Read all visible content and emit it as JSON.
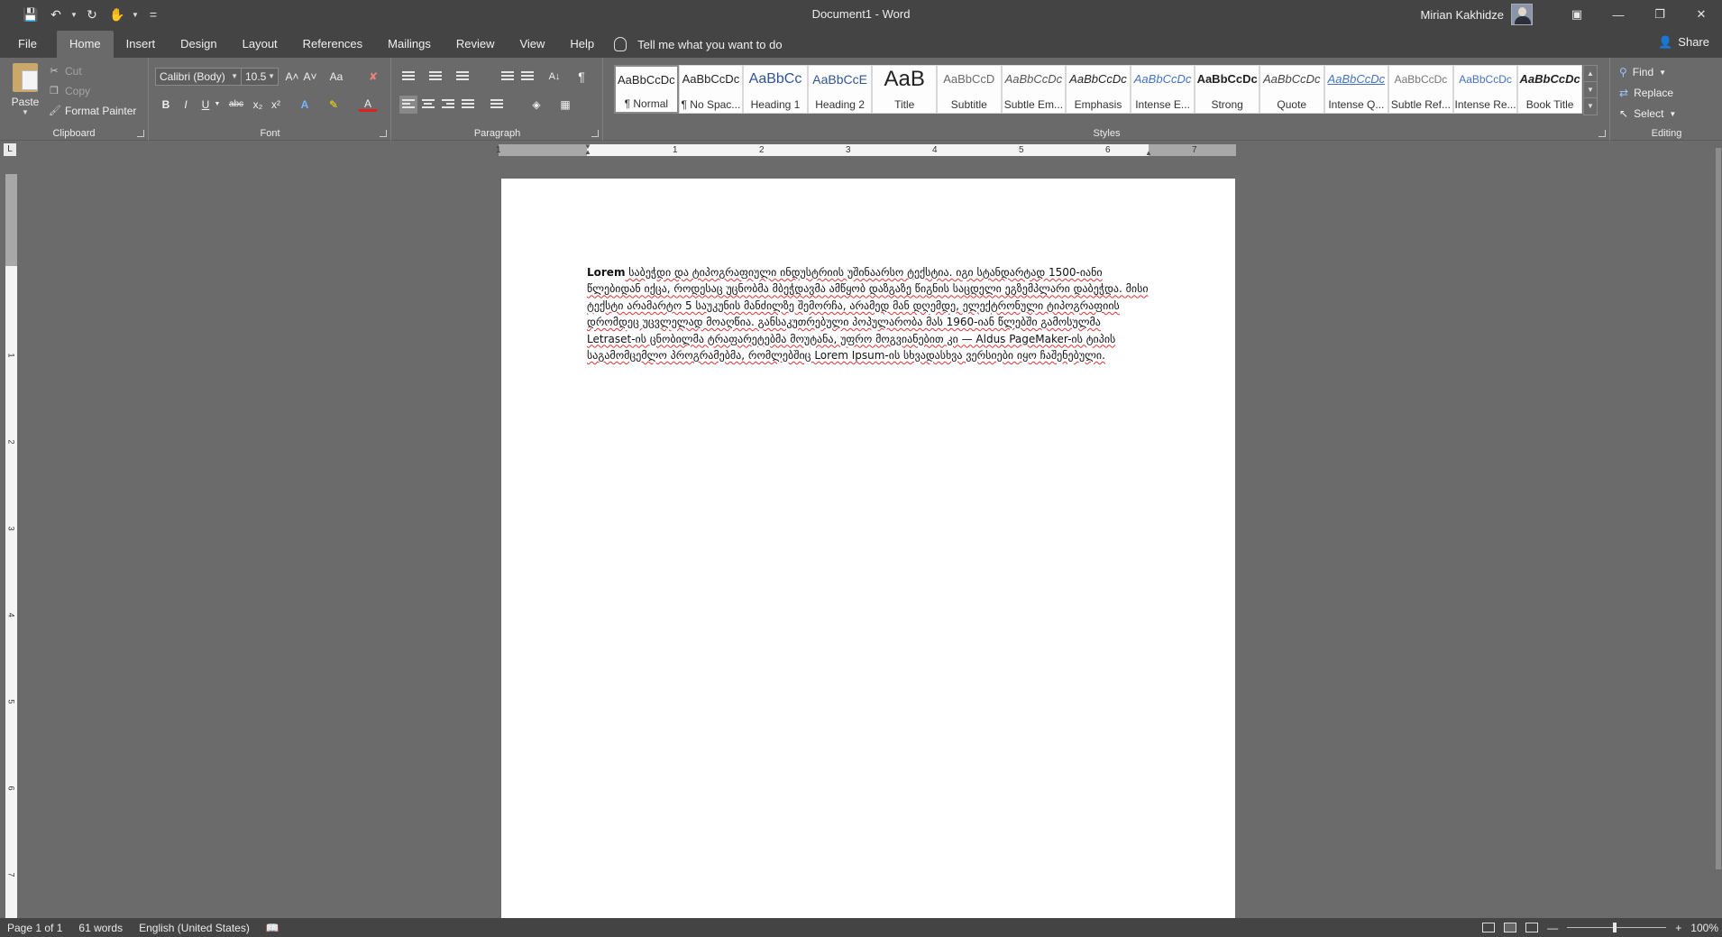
{
  "titlebar": {
    "doc_title": "Document1 - Word",
    "user_name": "Mirian Kakhidze",
    "qat_more": "="
  },
  "tabs": [
    {
      "label": "File"
    },
    {
      "label": "Home"
    },
    {
      "label": "Insert"
    },
    {
      "label": "Design"
    },
    {
      "label": "Layout"
    },
    {
      "label": "References"
    },
    {
      "label": "Mailings"
    },
    {
      "label": "Review"
    },
    {
      "label": "View"
    },
    {
      "label": "Help"
    }
  ],
  "tellme": "Tell me what you want to do",
  "share": "Share",
  "clipboard": {
    "paste": "Paste",
    "cut": "Cut",
    "copy": "Copy",
    "format_painter": "Format Painter",
    "label": "Clipboard"
  },
  "font": {
    "name": "Calibri (Body)",
    "size": "10.5",
    "grow": "A˄",
    "shrink": "A˅",
    "case": "Aa",
    "bold": "B",
    "italic": "I",
    "underline": "U",
    "strike": "abc",
    "subscript": "x₂",
    "superscript": "x²",
    "effects": "A",
    "font_color": "A",
    "label": "Font"
  },
  "paragraph": {
    "label": "Paragraph",
    "sort": "A↓",
    "pilcrow": "¶"
  },
  "styles": {
    "label": "Styles",
    "items": [
      {
        "preview": "AaBbCcDc",
        "name": "¶ Normal"
      },
      {
        "preview": "AaBbCcDc",
        "name": "¶ No Spac..."
      },
      {
        "preview": "AaBbCc",
        "name": "Heading 1"
      },
      {
        "preview": "AaBbCcE",
        "name": "Heading 2"
      },
      {
        "preview": "AaB",
        "name": "Title"
      },
      {
        "preview": "AaBbCcD",
        "name": "Subtitle"
      },
      {
        "preview": "AaBbCcDc",
        "name": "Subtle Em..."
      },
      {
        "preview": "AaBbCcDc",
        "name": "Emphasis"
      },
      {
        "preview": "AaBbCcDc",
        "name": "Intense E..."
      },
      {
        "preview": "AaBbCcDc",
        "name": "Strong"
      },
      {
        "preview": "AaBbCcDc",
        "name": "Quote"
      },
      {
        "preview": "AaBbCcDc",
        "name": "Intense Q..."
      },
      {
        "preview": "AaBbCcDc",
        "name": "Subtle Ref..."
      },
      {
        "preview": "AaBbCcDc",
        "name": "Intense Re..."
      },
      {
        "preview": "AaBbCcDc",
        "name": "Book Title"
      }
    ]
  },
  "editing": {
    "find": "Find",
    "replace": "Replace",
    "select": "Select",
    "label": "Editing"
  },
  "ruler": {
    "numbers": [
      "1",
      "1",
      "2",
      "3",
      "4",
      "5",
      "6",
      "7"
    ],
    "vnumbers": [
      "1",
      "1",
      "2",
      "3",
      "4",
      "5",
      "6",
      "7"
    ]
  },
  "document": {
    "first_word": "Lorem",
    "body": " საბეჭდი და ტიპოგრაფიული ინდუსტრიის უშინაარსო ტექსტია. იგი სტანდარტად 1500-იანი წლებიდან იქცა, როდესაც უცნობმა მბეჭდავმა ამწყობ დაზგაზე წიგნის საცდელი ეგზემპლარი დაბეჭდა. მისი ტექსტი არამარტო 5 საუკუნის მანძილზე შემორჩა, არამედ მან დღემდე, ელექტრონული ტიპოგრაფიის დრომდეც უცვლელად მოაღწია. განსაკუთრებული პოპულარობა მას 1960-იან წლებში გამოსულმა Letraset-ის ცნობილმა ტრაფარეტებმა მოუტანა, უფრო მოგვიანებით კი — Aldus PageMaker-ის ტიპის საგამომცემლო პროგრამებმა, რომლებშიც Lorem Ipsum-ის სხვადასხვა ვერსიები იყო ჩაშენებული."
  },
  "status": {
    "page": "Page 1 of 1",
    "words": "61 words",
    "language": "English (United States)",
    "zoom": "100%"
  }
}
